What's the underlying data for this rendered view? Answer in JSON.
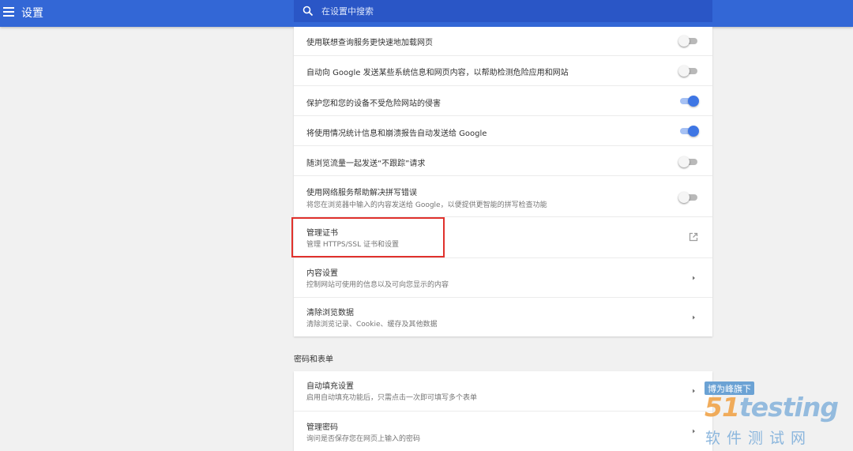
{
  "header": {
    "title": "设置",
    "search_placeholder": "在设置中搜索"
  },
  "colors": {
    "header_bg": "#3367d6",
    "toggle_on": "#3e76e4",
    "highlight_border": "#e0312c"
  },
  "privacy": {
    "rows": [
      {
        "label": "使用联想查询服务更快速地加载网页",
        "control": "toggle",
        "state": "off"
      },
      {
        "label": "自动向 Google 发送某些系统信息和网页内容，以帮助检测危险应用和网站",
        "control": "toggle",
        "state": "off"
      },
      {
        "label": "保护您和您的设备不受危险网站的侵害",
        "control": "toggle",
        "state": "on"
      },
      {
        "label": "将使用情况统计信息和崩溃报告自动发送给 Google",
        "control": "toggle",
        "state": "on"
      },
      {
        "label": "随浏览流量一起发送“不跟踪”请求",
        "control": "toggle",
        "state": "off"
      },
      {
        "label": "使用网络服务帮助解决拼写错误",
        "sublabel": "将您在浏览器中输入的内容发送给 Google，以便提供更智能的拼写检查功能",
        "control": "toggle",
        "state": "off"
      },
      {
        "label": "管理证书",
        "sublabel": "管理 HTTPS/SSL 证书和设置",
        "control": "external-link"
      },
      {
        "label": "内容设置",
        "sublabel": "控制网站可使用的信息以及可向您显示的内容",
        "control": "chevron"
      },
      {
        "label": "清除浏览数据",
        "sublabel": "清除浏览记录、Cookie、缓存及其他数据",
        "control": "chevron"
      }
    ]
  },
  "passwords_section": {
    "title": "密码和表单",
    "rows": [
      {
        "label": "自动填充设置",
        "sublabel": "启用自动填充功能后，只需点击一次即可填写多个表单",
        "control": "chevron"
      },
      {
        "label": "管理密码",
        "sublabel": "询问是否保存您在网页上输入的密码",
        "control": "chevron"
      }
    ]
  },
  "watermark": {
    "badge": "博为峰旗下",
    "logo_num": "51",
    "logo_text": "testing",
    "subtitle": "软件测试网"
  }
}
